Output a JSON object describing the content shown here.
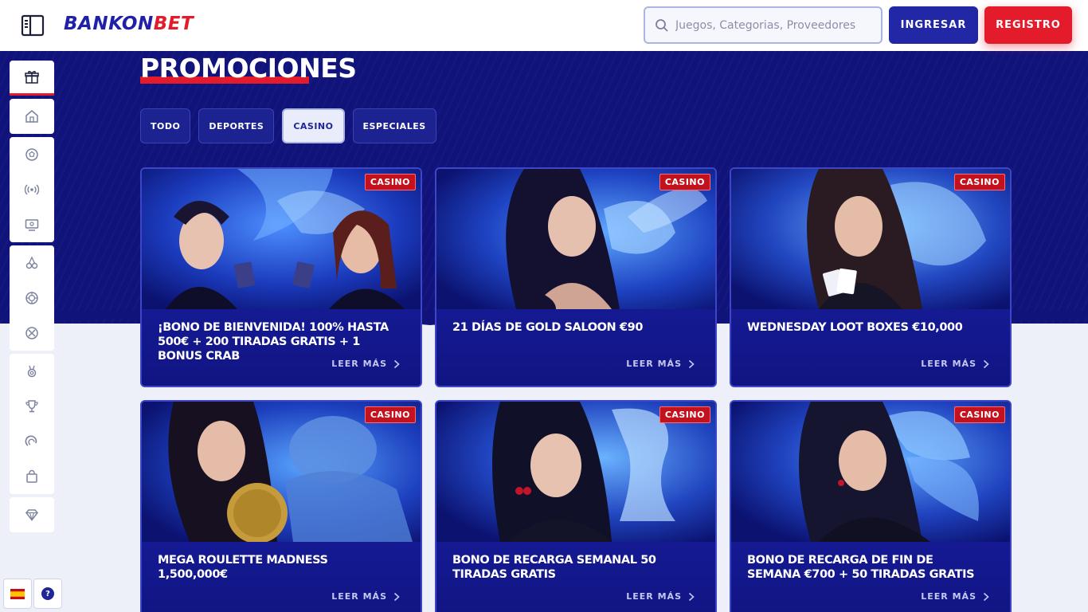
{
  "header": {
    "logo_part1": "BANKON",
    "logo_part2": "BET",
    "search_placeholder": "Juegos, Categorias, Proveedores",
    "login_label": "INGRESAR",
    "register_label": "REGISTRO"
  },
  "page": {
    "title": "PROMOCIONES",
    "filters": [
      {
        "label": "TODO"
      },
      {
        "label": "DEPORTES"
      },
      {
        "label": "CASINO"
      },
      {
        "label": "ESPECIALES"
      }
    ]
  },
  "cards": [
    {
      "badge": "CASINO",
      "title": "¡BONO DE BIENVENIDA! 100% HASTA 500€ + 200 TIRADAS GRATIS + 1 BONUS CRAB",
      "link": "LEER MÁS"
    },
    {
      "badge": "CASINO",
      "title": "21 DÍAS DE GOLD SALOON €90",
      "link": "LEER MÁS"
    },
    {
      "badge": "CASINO",
      "title": "WEDNESDAY LOOT BOXES €10,000",
      "link": "LEER MÁS"
    },
    {
      "badge": "CASINO",
      "title": "MEGA ROULETTE MADNESS 1,500,000€",
      "link": "LEER MÁS"
    },
    {
      "badge": "CASINO",
      "title": "BONO DE RECARGA SEMANAL 50 TIRADAS GRATIS",
      "link": "LEER MÁS"
    },
    {
      "badge": "CASINO",
      "title": "BONO DE RECARGA DE FIN DE SEMANA €700 + 50 TIRADAS GRATIS",
      "link": "LEER MÁS"
    }
  ],
  "footer_left": {
    "help_glyph": "?"
  },
  "colors": {
    "brand_blue": "#1f22a8",
    "brand_red": "#e41b2a",
    "hero_bg": "#10137a"
  }
}
